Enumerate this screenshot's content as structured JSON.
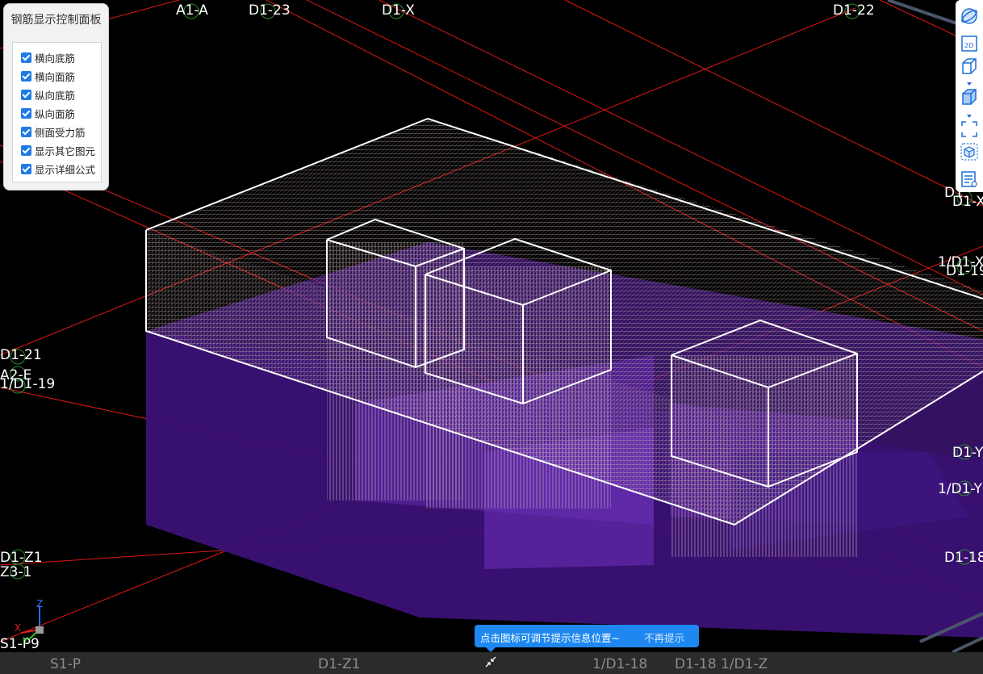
{
  "control_panel": {
    "title": "钢筋显示控制面板",
    "items": [
      {
        "label": "横向底筋",
        "checked": true
      },
      {
        "label": "横向面筋",
        "checked": true
      },
      {
        "label": "纵向底筋",
        "checked": true
      },
      {
        "label": "纵向面筋",
        "checked": true
      },
      {
        "label": "侧面受力筋",
        "checked": true
      },
      {
        "label": "显示其它图元",
        "checked": true
      },
      {
        "label": "显示详细公式",
        "checked": true
      }
    ]
  },
  "axis_labels": {
    "a1a": "A1-A",
    "d1_23": "D1-23",
    "d1_x_top": "D1-X",
    "d1_22": "D1-22",
    "d1_21": "D1-21",
    "a2_e": "A2-E",
    "d1_19": "1/D1-19",
    "d1_xr": "D1-X",
    "d1r": "D1",
    "d1_x_frac": "1/D1-X",
    "d1_19r": "D1-19",
    "d1_y": "D1-Y",
    "d1_y_frac": "1/D1-Y",
    "d1_18r": "D1-18",
    "d1_z1_left": "D1-Z1",
    "z3_1": "Z3-1",
    "s1_p9": "S1-P9",
    "d1_y_small": "D1-Y",
    "s1_p_small": "S1-P"
  },
  "bottom_labels": {
    "s1_p": "S1-P",
    "d1_z1": "D1-Z1",
    "d1_18_frac": "1/D1-18",
    "d1_18": "D1-18",
    "d1_z_frac": "1/D1-Z"
  },
  "triad": {
    "x": "X",
    "y": "Y",
    "z": "Z"
  },
  "tooltip": {
    "message": "点击图标可调节提示信息位置~",
    "dismiss": "不再提示"
  },
  "toolbar": {
    "icons": [
      "orbit-icon",
      "2d-view-icon",
      "cube-view-icon",
      "solid-cube-icon",
      "fullscreen-icon",
      "3d-box-icon",
      "list-view-icon"
    ],
    "view_2d_text": "2D"
  },
  "colors": {
    "background": "#000000",
    "grid_line": "#e01818",
    "concrete": "#4b1a8c",
    "rebar": "#d9c3c3",
    "outline": "#ffffff",
    "accent": "#1e88f0"
  }
}
